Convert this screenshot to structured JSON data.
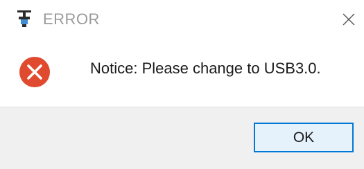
{
  "window": {
    "title": "ERROR",
    "app_icon": "usb-device-icon",
    "close_icon": "close-icon"
  },
  "content": {
    "icon": "error-icon",
    "message": "Notice: Please change to USB3.0."
  },
  "footer": {
    "ok_label": "OK"
  },
  "colors": {
    "error_red": "#e04a2f",
    "button_border": "#0078d7",
    "button_fill": "#e5f1fb",
    "footer_bg": "#f0f0f0",
    "title_text": "#9a9a9a"
  }
}
